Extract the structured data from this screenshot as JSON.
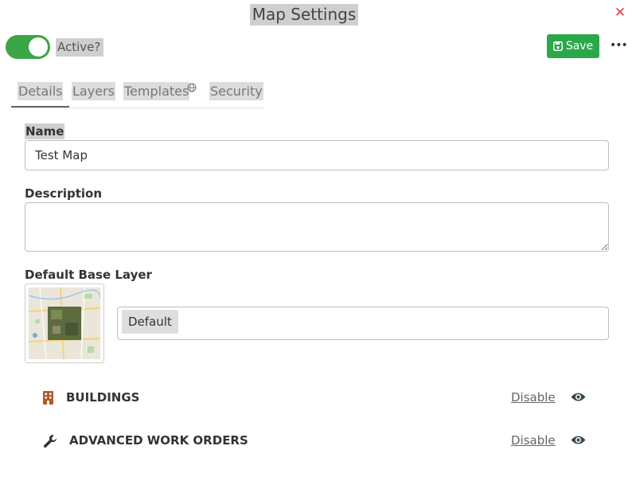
{
  "header": {
    "title": "Map Settings",
    "close_icon": "close-icon",
    "active_label": "Active?",
    "active_on": true,
    "save_label": "Save",
    "more_icon": "ellipsis-icon"
  },
  "tabs": [
    {
      "label": "Details",
      "active": true
    },
    {
      "label": "Layers"
    },
    {
      "label": "Templates",
      "icon": "globe-icon"
    },
    {
      "label": "Security"
    }
  ],
  "form": {
    "name_label": "Name",
    "name_value": "Test Map",
    "description_label": "Description",
    "description_value": "",
    "base_layer_label": "Default Base Layer",
    "base_layer_value": "Default"
  },
  "layers": [
    {
      "label": "BUILDINGS",
      "icon": "building-icon",
      "action": "Disable"
    },
    {
      "label": "ADVANCED WORK ORDERS",
      "icon": "wrench-icon",
      "action": "Disable"
    }
  ],
  "colors": {
    "accent_green": "#2aa84a",
    "close_red": "#e23b3b",
    "building_icon": "#b5582b",
    "eye_icon": "#37474f"
  }
}
